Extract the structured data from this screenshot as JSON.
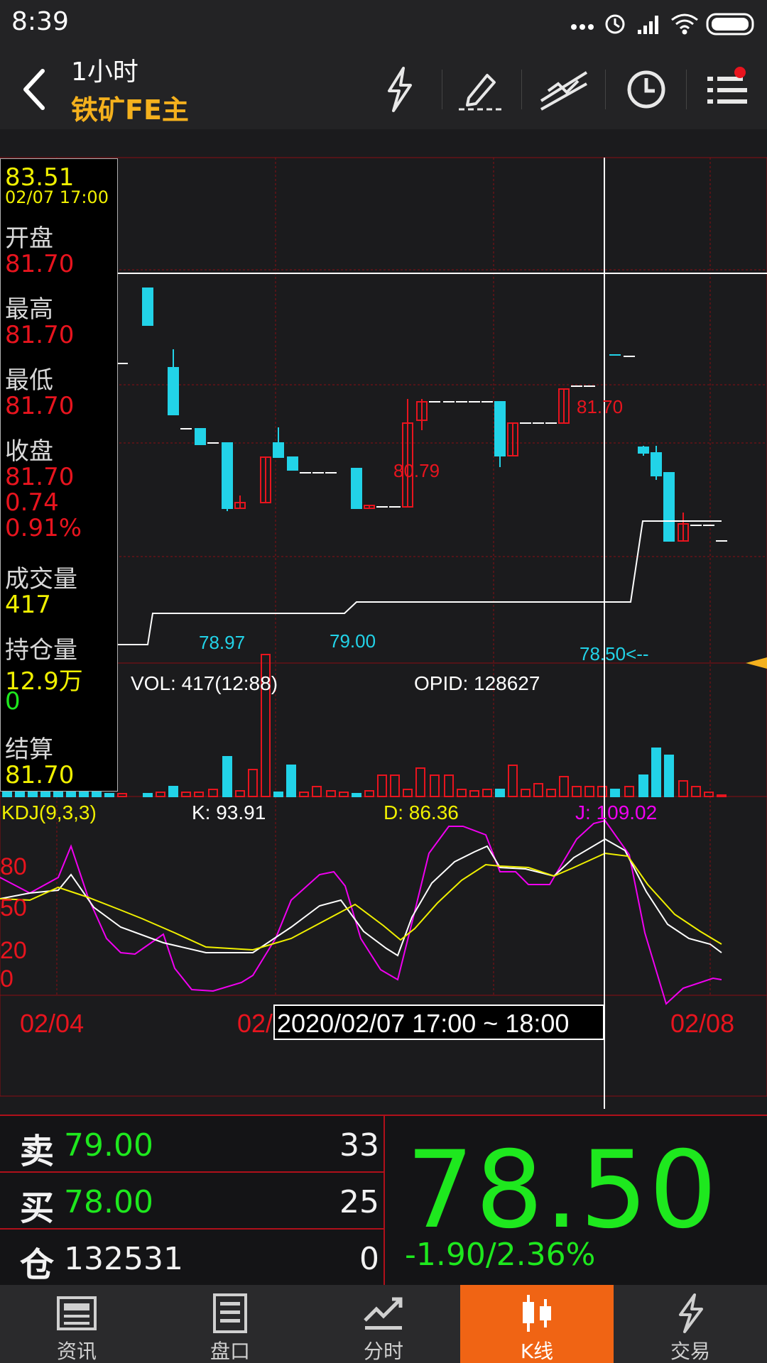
{
  "status_bar": {
    "time": "8:39"
  },
  "header": {
    "period": "1小时",
    "contract": "铁矿FE主"
  },
  "info_panel": {
    "crosshair_price": "83.51",
    "crosshair_time": "02/07 17:00",
    "open_label": "开盘",
    "open": "81.70",
    "high_label": "最高",
    "high": "81.70",
    "low_label": "最低",
    "low": "81.70",
    "close_label": "收盘",
    "close": "81.70",
    "change": "0.74",
    "change_pct": "0.91%",
    "volume_label": "成交量",
    "volume": "417",
    "oi_label": "持仓量",
    "oi": "12.9万",
    "oi_change": "0",
    "settle_label": "结算",
    "settle": "81.70"
  },
  "chart_data": {
    "type": "candlestick",
    "annotations": [
      {
        "text": "81.70",
        "color": "#e8141e"
      },
      {
        "text": "80.79",
        "color": "#e8141e"
      },
      {
        "text": "78.97",
        "color": "#22d3e8"
      },
      {
        "text": "79.00",
        "color": "#22d3e8"
      },
      {
        "text": "78.50<--",
        "color": "#22d3e8"
      }
    ],
    "volume_label": "VOL: 417(12:88)",
    "opid_label": "OPID: 128627",
    "kdj": {
      "title": "KDJ(9,3,3)",
      "k_label": "K: 93.91",
      "d_label": "D: 86.36",
      "j_label": "J: 109.02",
      "k_color": "#ffffff",
      "d_color": "#f0f000",
      "j_color": "#f000f0",
      "y_ticks": [
        "80",
        "50",
        "20",
        "0"
      ]
    },
    "x_ticks": [
      "02/04",
      "02/",
      "02/08"
    ],
    "crosshair_time_range": "2020/02/07 17:00 ~ 18:00"
  },
  "quote": {
    "sell_label": "卖",
    "sell_price": "79.00",
    "sell_vol": "33",
    "buy_label": "买",
    "buy_price": "78.00",
    "buy_vol": "25",
    "oi_label": "仓",
    "oi_value": "132531",
    "oi_change": "0",
    "last_price": "78.50",
    "change": "-1.90/2.36%"
  },
  "nav": [
    {
      "label": "资讯",
      "icon": "news-icon"
    },
    {
      "label": "盘口",
      "icon": "order-book-icon"
    },
    {
      "label": "分时",
      "icon": "timeshare-icon"
    },
    {
      "label": "K线",
      "icon": "candlestick-icon"
    },
    {
      "label": "交易",
      "icon": "trade-icon"
    }
  ],
  "colors": {
    "up": "#e8141e",
    "down": "#22d3e8",
    "accent": "#f06414",
    "price_green": "#1ee81e"
  }
}
